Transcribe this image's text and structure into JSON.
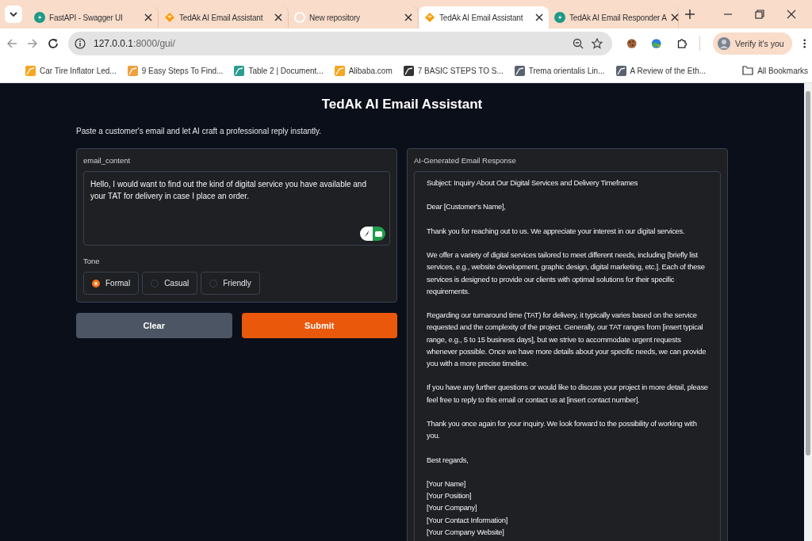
{
  "browser": {
    "tabs": [
      {
        "title": "FastAPI - Swagger UI",
        "selected": false,
        "kind": "circle",
        "color": "#1b9a87"
      },
      {
        "title": "TedAk AI Email Assistant",
        "selected": false,
        "kind": "diamond",
        "color": "#f59e0b"
      },
      {
        "title": "New repository",
        "selected": false,
        "kind": "ring",
        "color": "#ffffff"
      },
      {
        "title": "TedAk AI Email Assistant",
        "selected": true,
        "kind": "diamond",
        "color": "#f59e0b"
      },
      {
        "title": "TedAk AI Email Responder A",
        "selected": false,
        "kind": "circle",
        "color": "#1b9a87"
      }
    ],
    "url_host": "127.0.0.1",
    "url_path": ":8000/gui/",
    "profile_button": "Verify it's you",
    "bookmarks": [
      {
        "title": "Car Tire Inflator Led...",
        "color": "#f5a623"
      },
      {
        "title": "9 Easy Steps To Find...",
        "color": "#f0a040"
      },
      {
        "title": "Table 2 | Document...",
        "color": "#2a9d8f"
      },
      {
        "title": "Alibaba.com",
        "color": "#f5a623"
      },
      {
        "title": "7 BASIC STEPS TO S...",
        "color": "#333333"
      },
      {
        "title": "Trema orientalis Lin...",
        "color": "#5a6270"
      },
      {
        "title": "A Review of the Eth...",
        "color": "#5a6270"
      }
    ],
    "all_bookmarks": "All Bookmarks"
  },
  "app": {
    "title": "TedAk AI Email Assistant",
    "subtitle": "Paste a customer's email and let AI craft a professional reply instantly.",
    "input": {
      "label": "email_content",
      "value": "Hello, I would want to find out the kind of digital service you have available and your TAT for delivery in case I place an order."
    },
    "tone": {
      "label": "Tone",
      "options": [
        {
          "label": "Formal",
          "selected": true
        },
        {
          "label": "Casual",
          "selected": false
        },
        {
          "label": "Friendly",
          "selected": false
        }
      ]
    },
    "buttons": [
      {
        "label": "Clear",
        "kind": "secondary"
      },
      {
        "label": "Submit",
        "kind": "primary"
      }
    ],
    "output": {
      "label": "AI-Generated Email Response",
      "paragraphs": [
        [
          "Subject: Inquiry About Our Digital Services and Delivery Timeframes"
        ],
        [
          "Dear [Customer's Name],"
        ],
        [
          "Thank you for reaching out to us. We appreciate your interest in our digital services."
        ],
        [
          "We offer a variety of digital services tailored to meet different needs, including [briefly list services, e.g., website development, graphic design, digital marketing, etc.]. Each of these services is designed to provide our clients with optimal solutions for their specific requirements."
        ],
        [
          "Regarding our turnaround time (TAT) for delivery, it typically varies based on the service requested and the complexity of the project. Generally, our TAT ranges from [insert typical range, e.g., 5 to 15 business days], but we strive to accommodate urgent requests whenever possible. Once we have more details about your specific needs, we can provide you with a more precise timeline."
        ],
        [
          "If you have any further questions or would like to discuss your project in more detail, please feel free to reply to this email or contact us at [insert contact number]."
        ],
        [
          "Thank you once again for your inquiry. We look forward to the possibility of working with you."
        ],
        [
          "Best regards,"
        ],
        [
          "[Your Name]",
          "[Your Position]",
          "[Your Company]",
          "[Your Contact Information]",
          "[Your Company Website]"
        ]
      ]
    }
  }
}
